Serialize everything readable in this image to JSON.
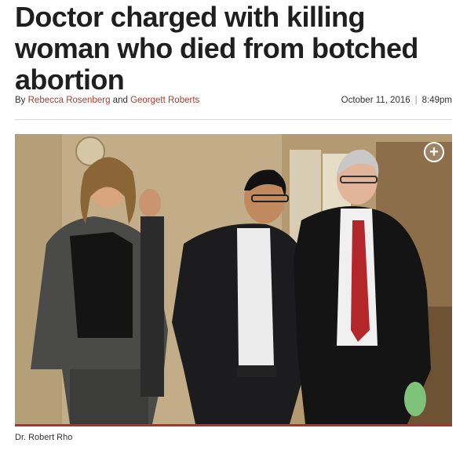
{
  "article": {
    "headline": "Doctor charged with killing woman who died from botched abortion",
    "byline_prefix": "By",
    "author1": "Rebecca Rosenberg",
    "byline_and": "and",
    "author2": "Georgett Roberts",
    "date": "October 11, 2016",
    "time": "8:49pm",
    "date_separator": "|"
  },
  "photo": {
    "caption": "Dr. Robert Rho",
    "expand_glyph": "+"
  },
  "colors": {
    "link": "#b03a2e",
    "accent_bar": "#b1302a"
  }
}
